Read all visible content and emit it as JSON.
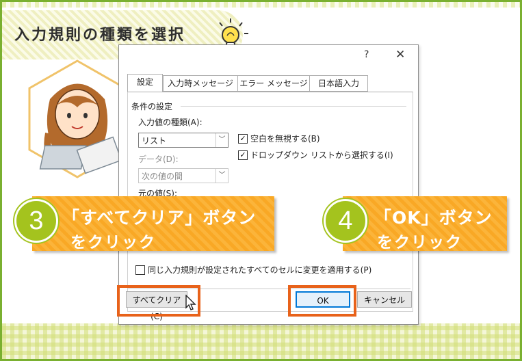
{
  "header": {
    "title": "入力規則の種類を選択"
  },
  "dialog": {
    "help_glyph": "?",
    "close_glyph": "✕",
    "tabs": [
      {
        "label": "設定",
        "active": true
      },
      {
        "label": "入力時メッセージ",
        "active": false
      },
      {
        "label": "エラー メッセージ",
        "active": false
      },
      {
        "label": "日本語入力",
        "active": false
      }
    ],
    "group_title": "条件の設定",
    "allow_label": "入力値の種類(A):",
    "allow_value": "リスト",
    "data_label": "データ(D):",
    "data_value": "次の値の間",
    "source_label": "元の値(S):",
    "ignore_blank_label": "空白を無視する(B)",
    "ignore_blank_checked": true,
    "dropdown_label": "ドロップダウン リストから選択する(I)",
    "dropdown_checked": true,
    "apply_all_label": "同じ入力規則が設定されたすべてのセルに変更を適用する(P)",
    "clear_all_button": "すべてクリア(C)",
    "ok_button": "OK",
    "cancel_button": "キャンセル"
  },
  "callouts": [
    {
      "number": "3",
      "line1": "「すべてクリア」ボタン",
      "line2": "をクリック"
    },
    {
      "number": "4",
      "line1": "「OK」ボタン",
      "line2": "をクリック"
    }
  ],
  "colors": {
    "accent_green": "#a4c31e",
    "callout_orange": "#f9a825",
    "highlight_orange": "#e8621a",
    "frame_green": "#7ab030"
  }
}
